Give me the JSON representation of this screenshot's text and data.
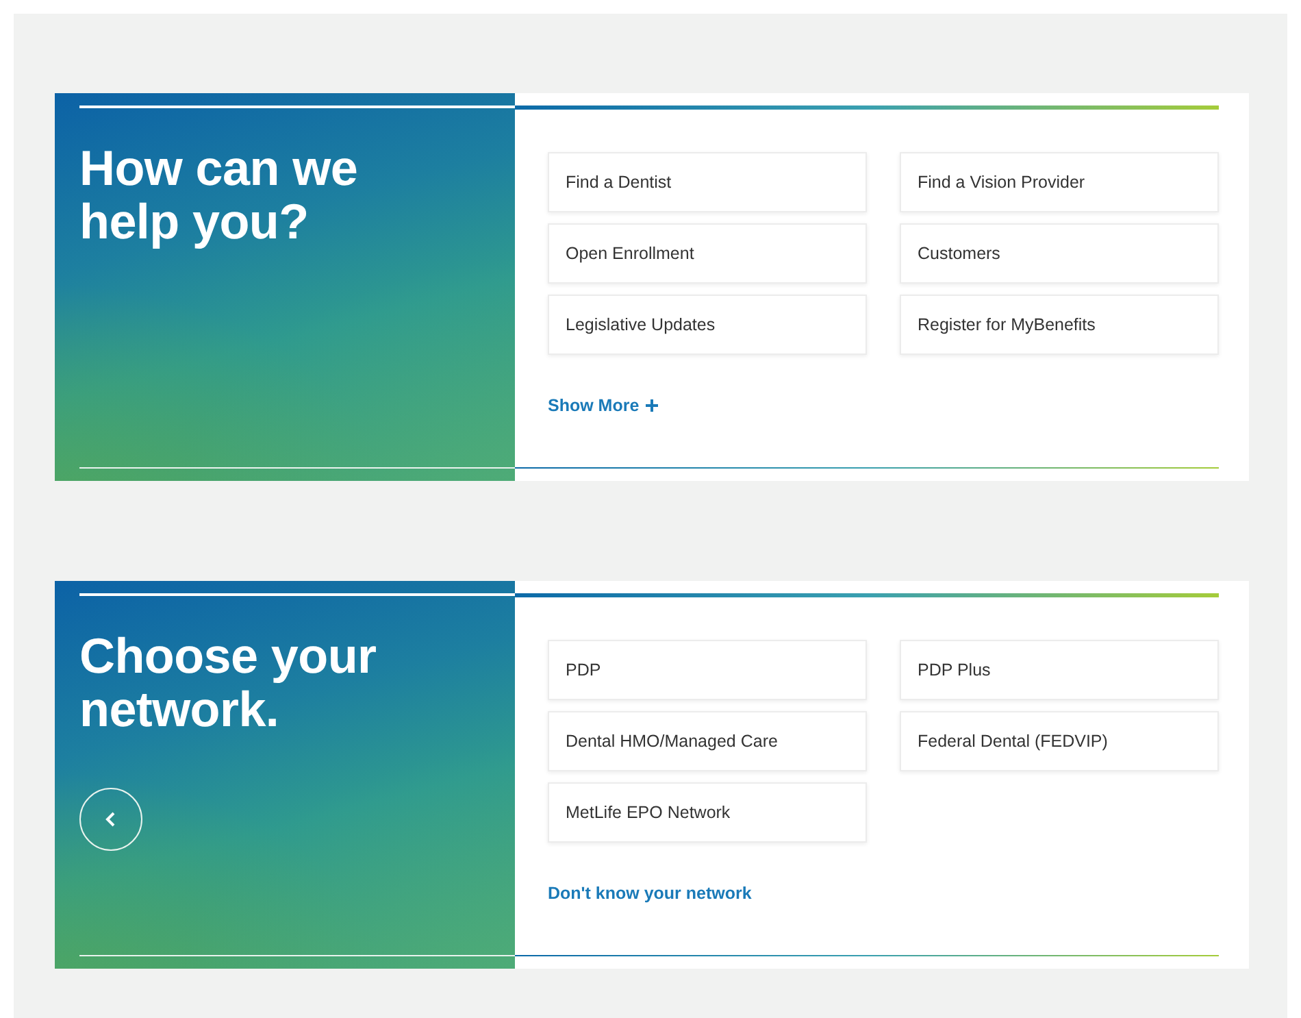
{
  "sections": [
    {
      "title": "How can we help you?",
      "has_back_button": false,
      "options": [
        {
          "label": "Find a Dentist"
        },
        {
          "label": "Find a Vision Provider"
        },
        {
          "label": "Open Enrollment"
        },
        {
          "label": "Customers"
        },
        {
          "label": "Legislative Updates"
        },
        {
          "label": "Register for MyBenefits"
        }
      ],
      "link": {
        "label": "Show More",
        "kind": "expand"
      }
    },
    {
      "title": "Choose your network.",
      "has_back_button": true,
      "options": [
        {
          "label": "PDP"
        },
        {
          "label": "PDP Plus"
        },
        {
          "label": "Dental HMO/Managed Care"
        },
        {
          "label": "Federal Dental (FEDVIP)"
        },
        {
          "label": "MetLife EPO Network"
        }
      ],
      "link": {
        "label": "Don't know your network",
        "kind": "plain"
      }
    }
  ]
}
